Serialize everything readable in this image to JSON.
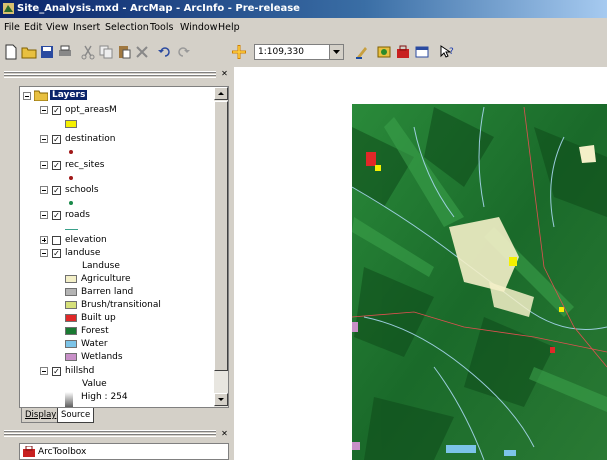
{
  "window": {
    "title": "Site_Analysis.mxd - ArcMap - ArcInfo - Pre-release"
  },
  "menubar": {
    "items": [
      "File",
      "Edit",
      "View",
      "Insert",
      "Selection",
      "Tools",
      "Window",
      "Help"
    ]
  },
  "toolbar": {
    "scale": "1:109,330",
    "icons": [
      "new-icon",
      "open-icon",
      "save-icon",
      "print-icon",
      "cut-icon",
      "copy-icon",
      "paste-icon",
      "delete-icon",
      "undo-icon",
      "redo-icon",
      "add-data-icon",
      "editor-icon",
      "arccatalog-icon",
      "arctoolbox-icon",
      "command-line-icon",
      "whats-this-icon"
    ]
  },
  "toc": {
    "root": "Layers",
    "layers": [
      {
        "name": "opt_areasM",
        "checked": true,
        "symbol": {
          "kind": "fill",
          "color": "#f5f000"
        }
      },
      {
        "name": "destination",
        "checked": true,
        "symbol": {
          "kind": "point",
          "color": "#a01818"
        }
      },
      {
        "name": "rec_sites",
        "checked": true,
        "symbol": {
          "kind": "point",
          "color": "#a01818"
        }
      },
      {
        "name": "schools",
        "checked": true,
        "symbol": {
          "kind": "point",
          "color": "#1a8a4a"
        }
      },
      {
        "name": "roads",
        "checked": true,
        "symbol": {
          "kind": "line",
          "color": "#3aa08a"
        }
      },
      {
        "name": "elevation",
        "checked": false,
        "collapsed": true
      },
      {
        "name": "landuse",
        "checked": true,
        "field": "Landuse",
        "classes": [
          {
            "label": "Agriculture",
            "color": "#f4f0c8"
          },
          {
            "label": "Barren land",
            "color": "#b4b4b4"
          },
          {
            "label": "Brush/transitional",
            "color": "#d6e07a"
          },
          {
            "label": "Built up",
            "color": "#e02828"
          },
          {
            "label": "Forest",
            "color": "#1a7a32"
          },
          {
            "label": "Water",
            "color": "#7cc4e8"
          },
          {
            "label": "Wetlands",
            "color": "#c890c8"
          }
        ]
      },
      {
        "name": "hillshd",
        "checked": true,
        "field": "Value",
        "high": "High : 254"
      }
    ]
  },
  "tabs": {
    "display": "Display",
    "source": "Source"
  },
  "arctoolbox": {
    "title": "ArcToolbox"
  }
}
